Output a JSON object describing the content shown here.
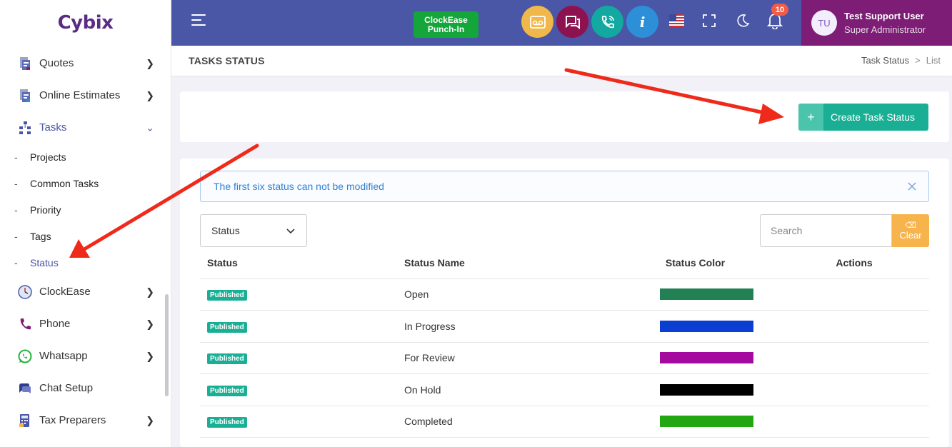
{
  "brand": {
    "logo_text": "Cybix"
  },
  "sidebar": {
    "items": [
      {
        "label": "Quotes",
        "icon": "quotes-document-icon",
        "has_chevron": true
      },
      {
        "label": "Online Estimates",
        "icon": "estimates-document-icon",
        "has_chevron": true
      },
      {
        "label": "Tasks",
        "icon": "tasks-tree-icon",
        "expanded": true
      },
      {
        "label": "ClockEase",
        "icon": "clock-icon",
        "has_chevron": true
      },
      {
        "label": "Phone",
        "icon": "phone-icon",
        "has_chevron": true
      },
      {
        "label": "Whatsapp",
        "icon": "whatsapp-icon",
        "has_chevron": true
      },
      {
        "label": "Chat Setup",
        "icon": "chat-icon",
        "has_chevron": false
      },
      {
        "label": "Tax Preparers",
        "icon": "calculator-icon",
        "has_chevron": true
      }
    ],
    "tasks_submenu": [
      {
        "label": "Projects"
      },
      {
        "label": "Common Tasks"
      },
      {
        "label": "Priority"
      },
      {
        "label": "Tags"
      },
      {
        "label": "Status",
        "active": true
      }
    ]
  },
  "topbar": {
    "clockease_line1": "ClockEase",
    "clockease_line2": "Punch-In",
    "notification_count": "10",
    "user_initials": "TU",
    "user_name": "Test Support User",
    "user_role": "Super Administrator",
    "colors": {
      "bar": "#4a56a6",
      "user_box": "#7d1d75"
    }
  },
  "page": {
    "title": "TASKS STATUS",
    "breadcrumb": [
      "Task Status",
      "List"
    ]
  },
  "actions": {
    "create_label": "Create Task Status",
    "create_plus": "+"
  },
  "alert": {
    "message": "The first six status can not be modified"
  },
  "filters": {
    "status_select": "Status",
    "search_placeholder": "Search",
    "clear_label": "Clear"
  },
  "table": {
    "headers": [
      "Status",
      "Status Name",
      "Status Color",
      "Actions"
    ],
    "rows": [
      {
        "status": "Published",
        "name": "Open",
        "color": "#238055"
      },
      {
        "status": "Published",
        "name": "In Progress",
        "color": "#0a3fd2"
      },
      {
        "status": "Published",
        "name": "For Review",
        "color": "#a50a9e"
      },
      {
        "status": "Published",
        "name": "On Hold",
        "color": "#000000"
      },
      {
        "status": "Published",
        "name": "Completed",
        "color": "#22a713"
      }
    ]
  },
  "accent_colors": {
    "teal": "#1aaf94",
    "orange": "#f7b44c",
    "annotation_arrow": "#f02a1a"
  }
}
